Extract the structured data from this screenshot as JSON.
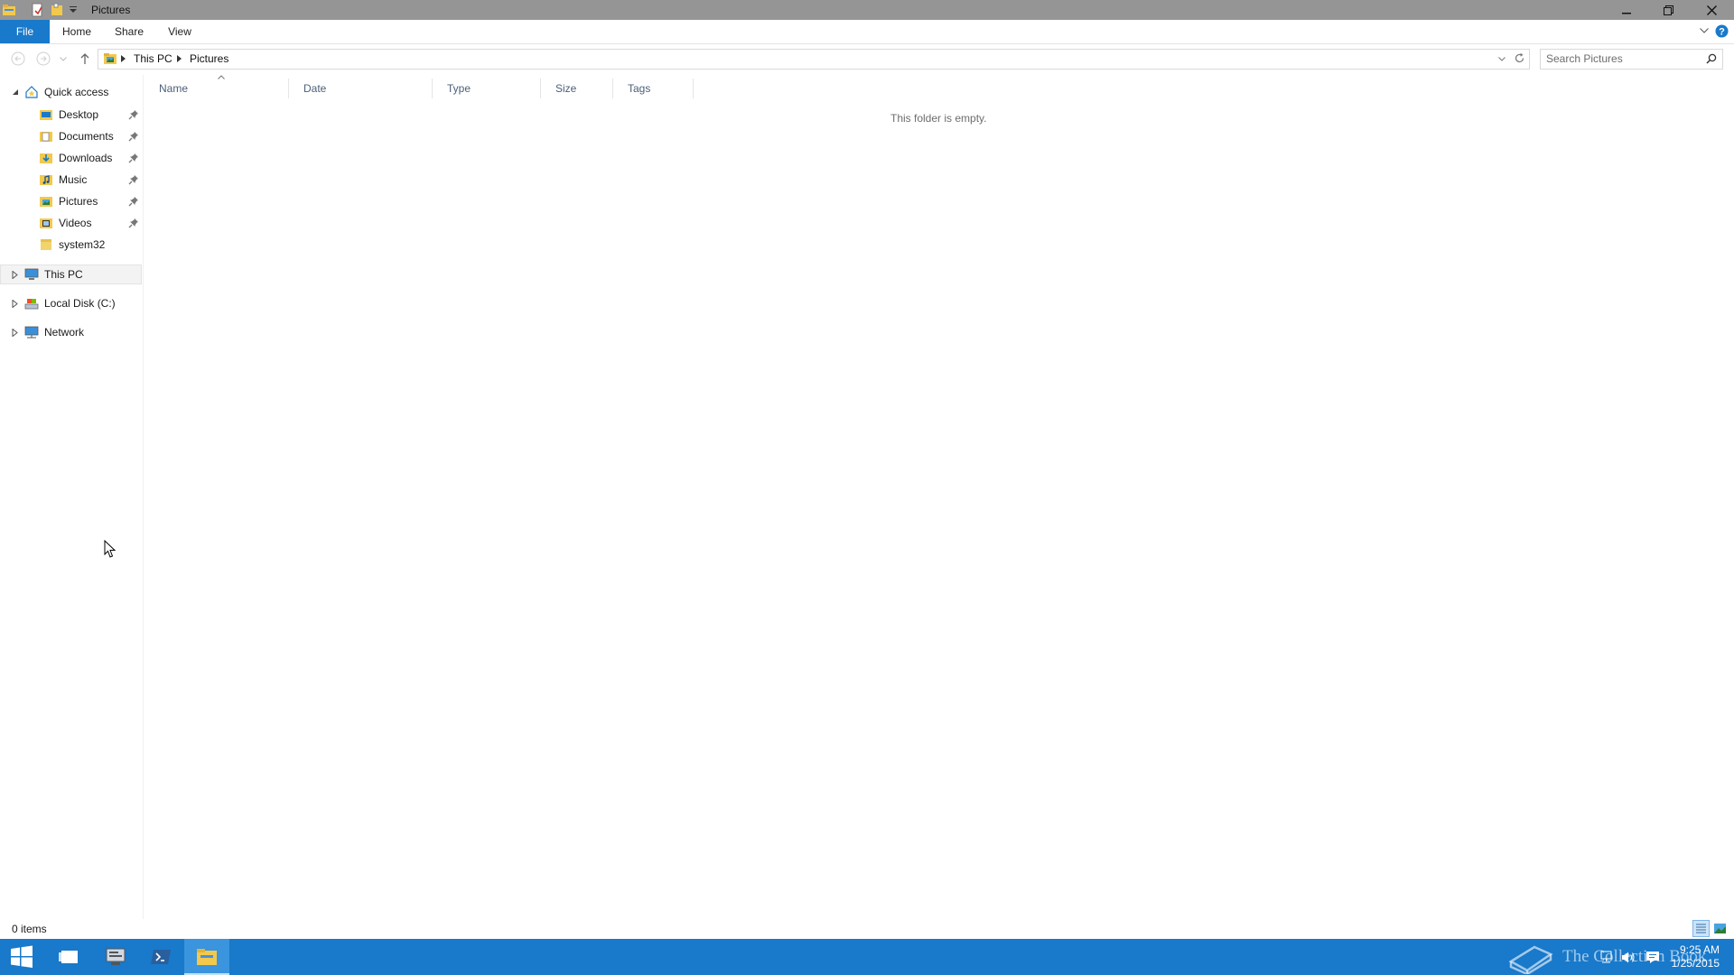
{
  "window": {
    "title": "Pictures"
  },
  "ribbon": {
    "tabs": [
      "File",
      "Home",
      "Share",
      "View"
    ]
  },
  "address": {
    "segments": [
      "This PC",
      "Pictures"
    ]
  },
  "search": {
    "placeholder": "Search Pictures"
  },
  "nav": {
    "quick_access": "Quick access",
    "pinned": [
      "Desktop",
      "Documents",
      "Downloads",
      "Music",
      "Pictures",
      "Videos"
    ],
    "recent": "system32",
    "this_pc": "This PC",
    "local_disk": "Local Disk (C:)",
    "network": "Network"
  },
  "columns": [
    "Name",
    "Date",
    "Type",
    "Size",
    "Tags"
  ],
  "content": {
    "empty_message": "This folder is empty."
  },
  "status": {
    "item_count": "0 items"
  },
  "taskbar": {
    "time": "9:25 AM",
    "date": "1/25/2015",
    "watermark": "The Collection Book"
  },
  "colors": {
    "accent": "#1979ca",
    "titlebar": "#959595",
    "folder": "#f2c94c"
  }
}
